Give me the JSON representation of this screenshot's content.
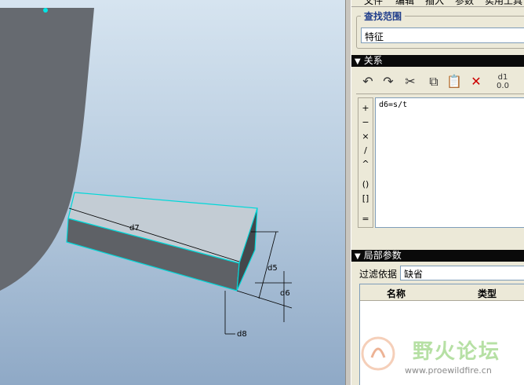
{
  "viewport": {
    "dimensions": {
      "d5": "d5",
      "d6": "d6",
      "d7": "d7",
      "d8": "d8"
    }
  },
  "menu": {
    "items": [
      "文件",
      "编辑",
      "插入",
      "参数",
      "实用工具"
    ]
  },
  "search_scope": {
    "title": "查找范围",
    "value": "特征"
  },
  "relations": {
    "title": "关系",
    "toolbar": {
      "undo": "undo-icon",
      "redo": "redo-icon",
      "cut": "cut-icon",
      "copy": "copy-icon",
      "paste": "paste-icon",
      "delete": "delete-icon",
      "evaluate": "evaluate-icon"
    },
    "operators": [
      "+",
      "−",
      "×",
      "/",
      "^",
      "()",
      "[]",
      "="
    ],
    "text": "d6=s/t"
  },
  "local_params": {
    "title": "局部参数",
    "filter_label": "过滤依据",
    "filter_value": "缺省",
    "columns": [
      "名称",
      "类型"
    ]
  },
  "watermark": {
    "title": "野火论坛",
    "url": "www.proewildfire.cn"
  }
}
